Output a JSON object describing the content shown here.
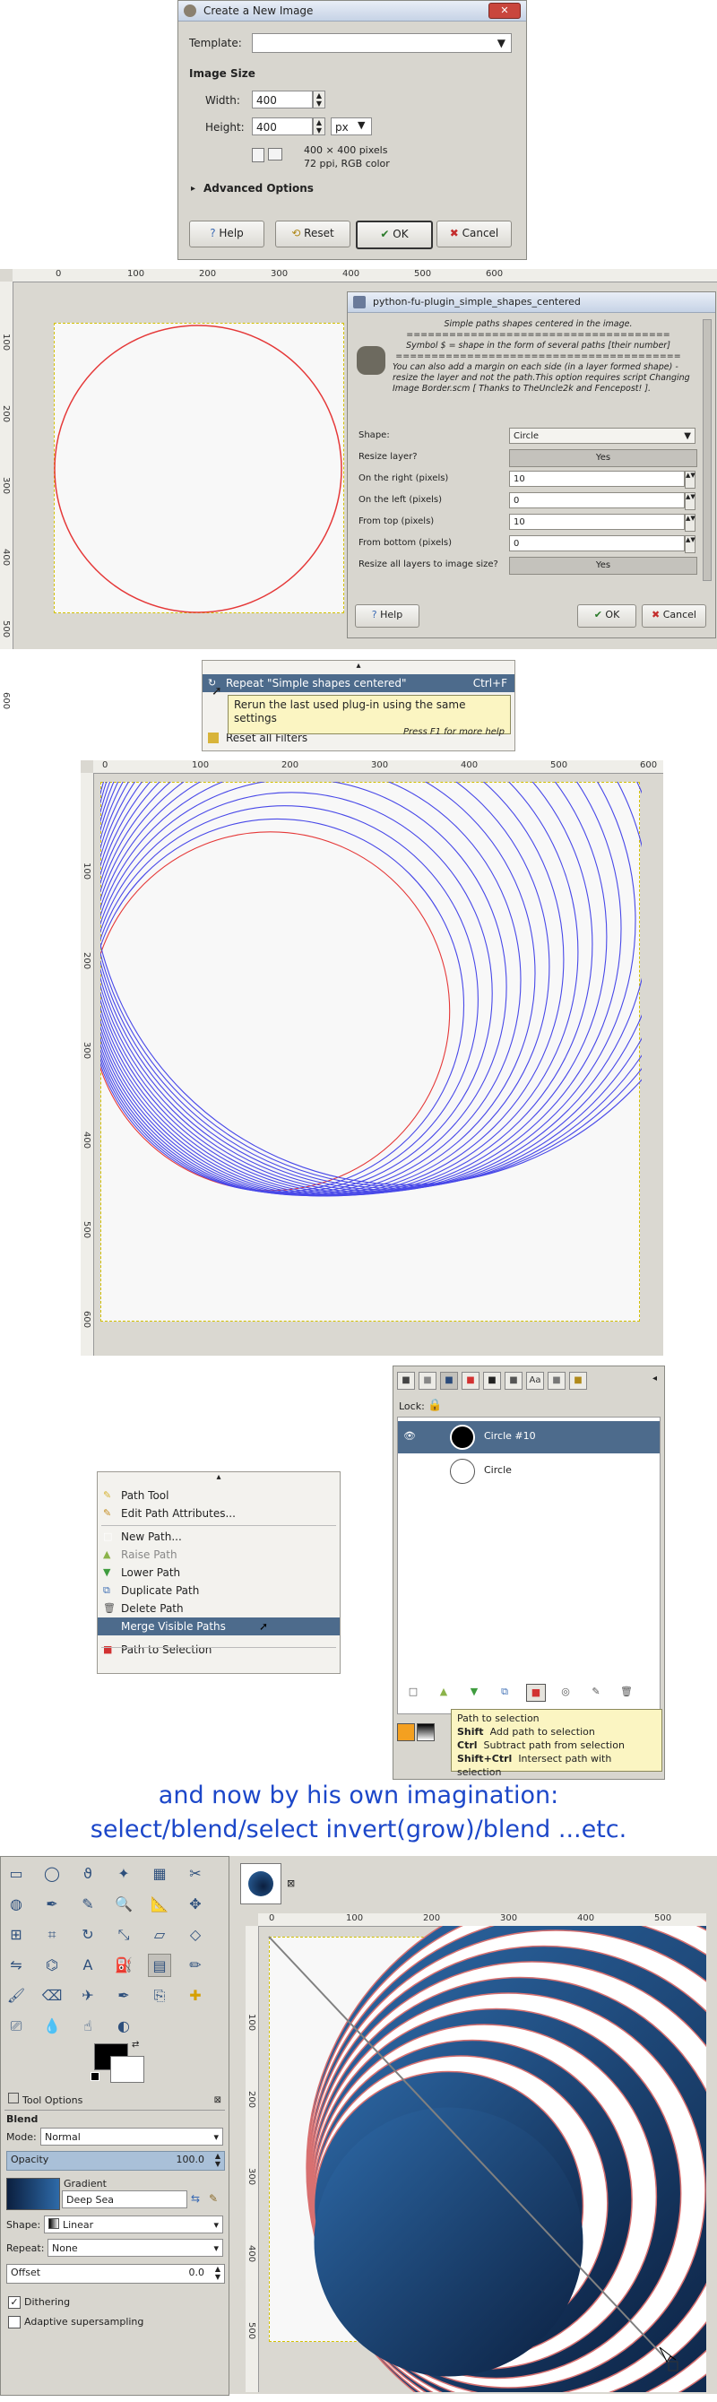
{
  "colors": {
    "accent": "#4d6b8c",
    "circle_red": "#e53838",
    "circle_blue": "#4848e8",
    "caption": "#1c47c9",
    "tooltip_bg": "#fbf5c2",
    "gradient_dark": "#0b1f3f",
    "gradient_light": "#2e6aa8"
  },
  "new_image": {
    "title": "Create a New Image",
    "template_label": "Template:",
    "image_size_label": "Image Size",
    "width_label": "Width:",
    "width_value": "400",
    "height_label": "Height:",
    "height_value": "400",
    "unit": "px",
    "info_line1": "400 × 400 pixels",
    "info_line2": "72 ppi, RGB color",
    "advanced_label": "Advanced Options",
    "help_button": "Help",
    "reset_button": "Reset",
    "ok_button": "OK",
    "cancel_button": "Cancel"
  },
  "plugin_dialog": {
    "title": "python-fu-plugin_simple_shapes_centered",
    "desc_line1": "Simple paths shapes centered in the image.",
    "desc_line2": "=====================================",
    "desc_line3": "Symbol $ = shape in the form of several paths [their number]",
    "desc_line4": "========================================",
    "desc_line5": "You can also add a margin on each side (in a layer formed shape) - resize the layer and not the path.This option requires script Changing Image Border.scm [ Thanks to TheUncle2k and Fencepost! ].",
    "rows": [
      {
        "label": "Shape:",
        "value": "Circle",
        "kind": "dropdown"
      },
      {
        "label": "Resize layer?",
        "value": "Yes",
        "kind": "toggle"
      },
      {
        "label": "On the right (pixels)",
        "value": "10",
        "kind": "spin"
      },
      {
        "label": "On the left (pixels)",
        "value": "0",
        "kind": "spin"
      },
      {
        "label": "From top (pixels)",
        "value": "10",
        "kind": "spin"
      },
      {
        "label": "From bottom (pixels)",
        "value": "0",
        "kind": "spin"
      },
      {
        "label": "Resize all layers to image size?",
        "value": "Yes",
        "kind": "toggle"
      }
    ],
    "help_button": "Help",
    "ok_button": "OK",
    "cancel_button": "Cancel"
  },
  "filters_menu": {
    "up_arrow": "▴",
    "repeat_item": "Repeat \"Simple shapes centered\"",
    "repeat_shortcut": "Ctrl+F",
    "partial_item": "Reset all Filters",
    "tooltip": "Rerun the last used plug-in using the same settings",
    "tooltip_hint": "Press F1 for more help"
  },
  "rulers_main": {
    "ticks": [
      "0",
      "100",
      "200",
      "300",
      "400",
      "500",
      "600"
    ],
    "vticks": [
      "100",
      "200",
      "300",
      "400",
      "500",
      "600"
    ]
  },
  "rulers_final": {
    "ticks": [
      "0",
      "100",
      "200",
      "300",
      "400",
      "500"
    ],
    "vticks": [
      "100",
      "200",
      "300",
      "400",
      "500"
    ]
  },
  "paths_menu": {
    "up_arrow": "▴",
    "items": [
      "Path Tool",
      "Edit Path Attributes...",
      "New Path...",
      "Raise Path",
      "Lower Path",
      "Duplicate Path",
      "Delete Path",
      "Merge Visible Paths",
      "Path to Selection"
    ]
  },
  "paths_panel": {
    "lock_label": "Lock:",
    "rows": [
      "Circle #10",
      "Circle"
    ],
    "tooltip_line1": "Path to selection",
    "tooltip_shift_key": "Shift",
    "tooltip_shift_text": "Add path to selection",
    "tooltip_ctrl_key": "Ctrl",
    "tooltip_ctrl_text": "Subtract path from selection",
    "tooltip_shiftctrl_key": "Shift+Ctrl",
    "tooltip_shiftctrl_text": "Intersect path with selection"
  },
  "caption": {
    "line1": "and now by his own  imagination:",
    "line2": "select/blend/select invert(grow)/blend ...etc."
  },
  "tool_options": {
    "tab_label": "Tool Options",
    "blend_label": "Blend",
    "mode_label": "Mode:",
    "mode_value": "Normal",
    "opacity_label": "Opacity",
    "opacity_value": "100.0",
    "gradient_label": "Gradient",
    "gradient_name": "Deep Sea",
    "shape_label": "Shape:",
    "shape_value": "Linear",
    "repeat_label": "Repeat:",
    "repeat_value": "None",
    "offset_label": "Offset",
    "offset_value": "0.0",
    "dithering_label": "Dithering",
    "adaptive_label": "Adaptive supersampling"
  }
}
